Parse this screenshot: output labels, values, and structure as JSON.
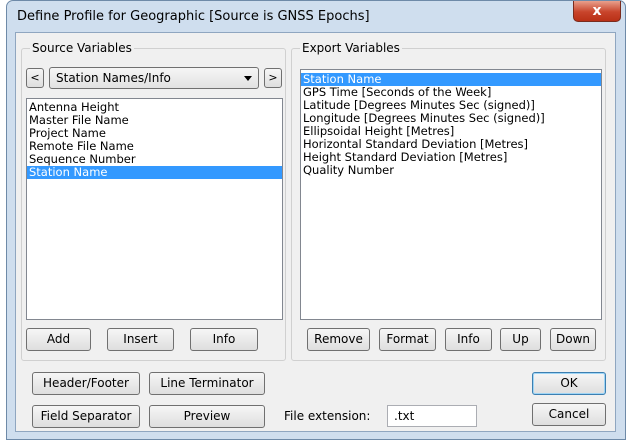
{
  "window": {
    "title": "Define Profile for Geographic [Source is GNSS Epochs]",
    "close_label": "x"
  },
  "source": {
    "group_title": "Source Variables",
    "prev_label": "<",
    "next_label": ">",
    "selector_value": "Station Names/Info",
    "items": [
      "Antenna Height",
      "Master File Name",
      "Project Name",
      "Remote File Name",
      "Sequence Number",
      "Station Name"
    ],
    "selected_index": 5,
    "buttons": {
      "add": "Add",
      "insert": "Insert",
      "info": "Info"
    }
  },
  "export": {
    "group_title": "Export Variables",
    "items": [
      "Station Name",
      "GPS Time [Seconds of the Week]",
      "Latitude [Degrees Minutes Sec (signed)]",
      "Longitude [Degrees Minutes Sec (signed)]",
      "Ellipsoidal Height [Metres]",
      "Horizontal Standard Deviation [Metres]",
      "Height Standard Deviation [Metres]",
      "Quality Number"
    ],
    "selected_index": 0,
    "buttons": {
      "remove": "Remove",
      "format": "Format",
      "info": "Info",
      "up": "Up",
      "down": "Down"
    }
  },
  "bottom": {
    "header_footer": "Header/Footer",
    "line_terminator": "Line Terminator",
    "field_separator": "Field Separator",
    "preview": "Preview",
    "file_extension_label": "File extension:",
    "file_extension_value": ".txt",
    "ok": "OK",
    "cancel": "Cancel"
  },
  "colors": {
    "selection": "#3399ff",
    "frame": "#cfdeee",
    "close": "#c8442b"
  }
}
